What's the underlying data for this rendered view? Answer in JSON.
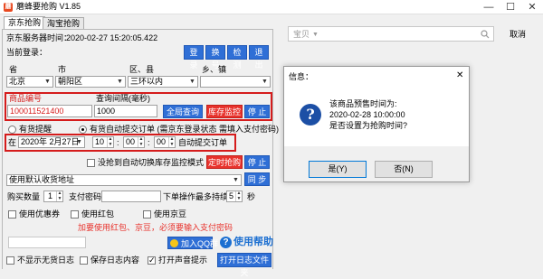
{
  "window": {
    "title": "蘑蜂要抢购 V1.85",
    "app_icon": "蘑",
    "minimize": "—",
    "maximize": "☐",
    "close": "✕"
  },
  "tabs": [
    {
      "label": "京东抢购",
      "active": true
    },
    {
      "label": "淘宝抢购",
      "active": false
    }
  ],
  "server_time": {
    "label": "京东服务器时间：",
    "value": "2020-02-27 15:20:05.422"
  },
  "login": {
    "label": "当前登录：",
    "buttons": {
      "login": "登 录",
      "switch": "换 号",
      "detect": "检 测",
      "logout": "退 出"
    }
  },
  "region": {
    "labels": {
      "province": "省",
      "city": "市",
      "district": "区、县",
      "town": "乡、镇"
    },
    "values": {
      "province": "北京",
      "city": "朝阳区",
      "district": "三环以内",
      "town": ""
    }
  },
  "product": {
    "id_label": "商品编号",
    "id_value": "100011521400",
    "interval_label": "查询间隔(毫秒)",
    "interval_value": "1000",
    "query_button": "全局查询",
    "monitor_button": "库存监控",
    "stop_button": "停 止"
  },
  "mode": {
    "in_stock_label": "有货提醒",
    "auto_submit_label": "有货自动提交订单 (需京东登录状态 需填入支付密码)"
  },
  "schedule": {
    "at_label": "在",
    "date": "2020年 2月27日",
    "hour": "10",
    "minute": "00",
    "second": "00",
    "submit_label": "自动提交订单"
  },
  "timer": {
    "switch_label": "没抢到自动切换库存监控模式",
    "timer_button": "定时抢购",
    "stop_button": "停 止"
  },
  "address": {
    "value": "使用默认收货地址",
    "sync_button": "同 步"
  },
  "purchase": {
    "qty_label": "购买数量",
    "qty_value": "1",
    "pay_pwd_label": "支付密码",
    "pay_pwd_value": "",
    "wait_label": "下单操作最多持续",
    "wait_value": "5",
    "wait_unit": "秒"
  },
  "options": {
    "coupon": "使用优惠券",
    "red_packet": "使用红包",
    "jd_bean": "使用京豆"
  },
  "warning": "加要使用红包、京豆，必须要输入支付密码",
  "footer": {
    "qq_group_button": "加入QQ群",
    "help_label": "使用帮助",
    "hide_logs": "不显示无货日志",
    "save_logs": "保存日志内容",
    "sound_alert": "打开声音提示",
    "open_log_folder": "打开日志文件夹"
  },
  "right": {
    "search_placeholder": "宝贝",
    "cancel": "取消"
  },
  "dialog": {
    "title": "信息：",
    "close": "✕",
    "line1": "该商品预售时间为:",
    "line2": "2020-02-28 10:00:00",
    "line3": "是否设置为抢购时间?",
    "yes": "是(Y)",
    "no": "否(N)",
    "icon": "?"
  },
  "colors": {
    "accent_blue": "#2f6fd6",
    "accent_red": "#e8322c",
    "highlight_border": "#d51c1c"
  }
}
